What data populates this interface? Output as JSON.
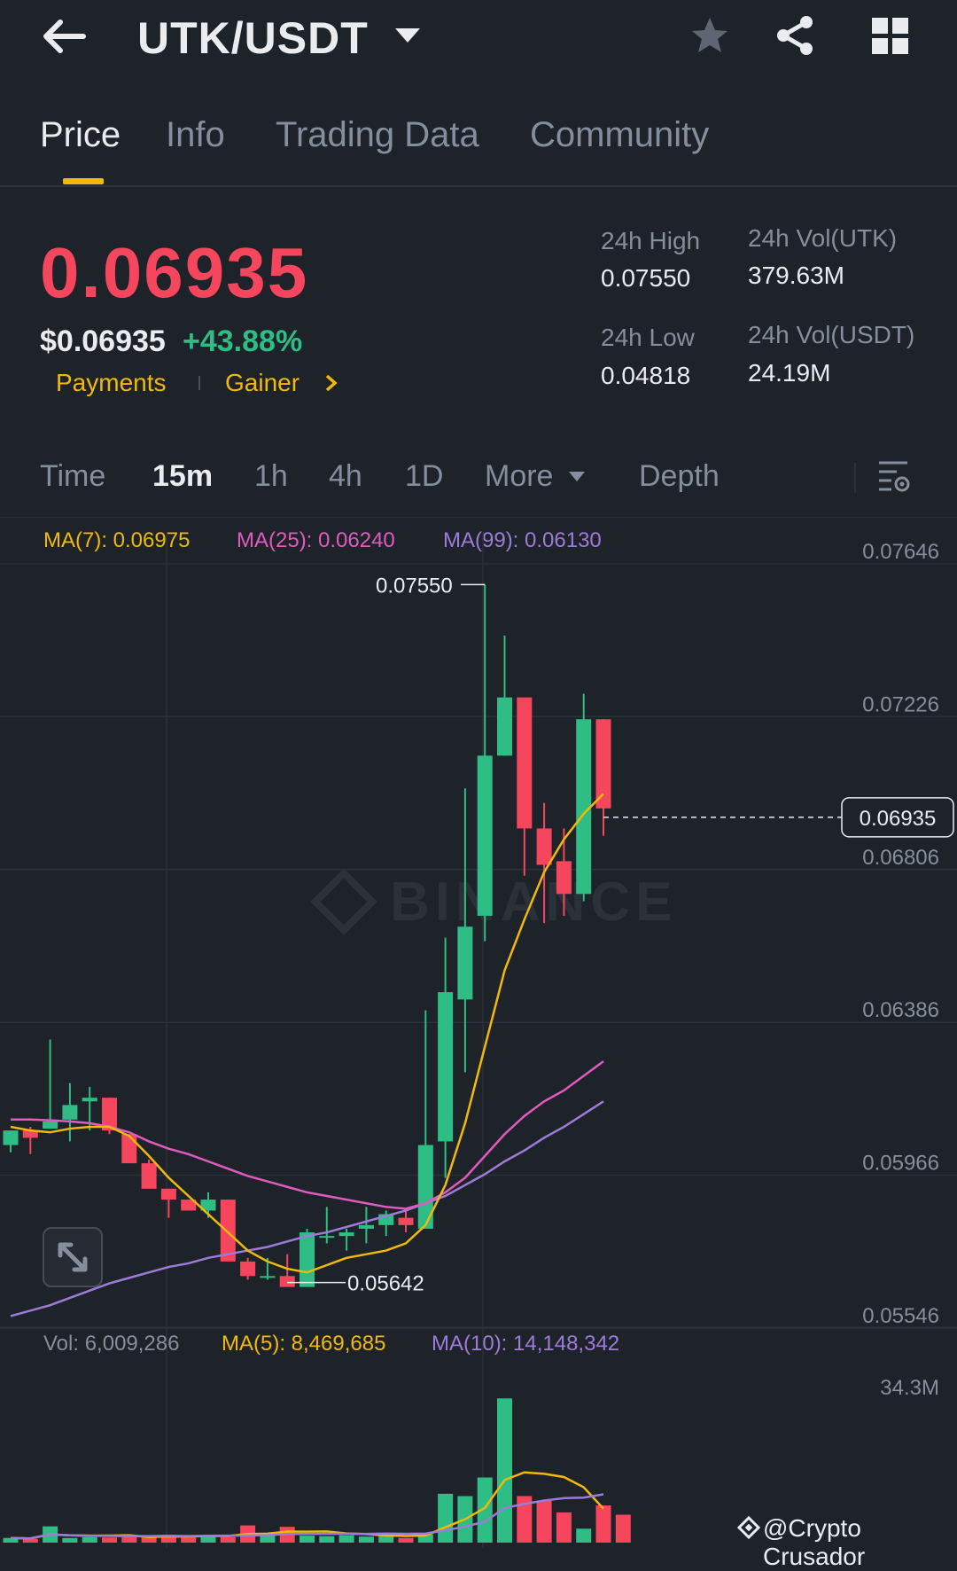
{
  "header": {
    "pair": "UTK/USDT",
    "icons": [
      "back-arrow-icon",
      "caret-down-icon",
      "star-icon",
      "share-icon",
      "grid-icon"
    ]
  },
  "tabs": [
    {
      "label": "Price",
      "active": true
    },
    {
      "label": "Info"
    },
    {
      "label": "Trading Data"
    },
    {
      "label": "Community"
    }
  ],
  "ticker": {
    "last_price": "0.06935",
    "usd_price": "$0.06935",
    "change_pct": "+43.88%",
    "tags": [
      "Payments",
      "Gainer"
    ],
    "high_label": "24h High",
    "high": "0.07550",
    "low_label": "24h Low",
    "low": "0.04818",
    "vol_base_label": "24h Vol(UTK)",
    "vol_base": "379.63M",
    "vol_quote_label": "24h Vol(USDT)",
    "vol_quote": "24.19M"
  },
  "intervals": [
    {
      "label": "Time"
    },
    {
      "label": "15m",
      "active": true
    },
    {
      "label": "1h"
    },
    {
      "label": "4h"
    },
    {
      "label": "1D"
    },
    {
      "label": "More"
    },
    {
      "label": "Depth"
    }
  ],
  "ma": {
    "ma7": "MA(7): 0.06975",
    "ma25": "MA(25): 0.06240",
    "ma99": "MA(99): 0.06130"
  },
  "vol_indicator": {
    "vol": "Vol: 6,009,286",
    "ma5": "MA(5): 8,469,685",
    "ma10": "MA(10): 14,148,342"
  },
  "watermark": "@Crypto Crusador",
  "colors": {
    "up": "#2ebd85",
    "down": "#f6465d",
    "ma7": "#f0b90b",
    "ma25": "#e05ac0",
    "ma99": "#9c7bd9",
    "accent": "#f0b90b",
    "bg": "#1e2329"
  },
  "chart_data": {
    "type": "candlestick",
    "y_ticks": [
      "0.07646",
      "0.07226",
      "0.06806",
      "0.06386",
      "0.05966",
      "0.05546"
    ],
    "ylim": [
      0.05546,
      0.07646
    ],
    "current_price_label": "0.06935",
    "high_marker": "0.07550",
    "low_marker": "0.05642",
    "candles": [
      {
        "o": 0.0601,
        "h": 0.0605,
        "l": 0.0599,
        "c": 0.0605
      },
      {
        "o": 0.0605,
        "h": 0.0606,
        "l": 0.05985,
        "c": 0.0603
      },
      {
        "o": 0.06055,
        "h": 0.063,
        "l": 0.06055,
        "c": 0.06075
      },
      {
        "o": 0.0608,
        "h": 0.0618,
        "l": 0.0602,
        "c": 0.0612
      },
      {
        "o": 0.0613,
        "h": 0.0617,
        "l": 0.0605,
        "c": 0.0614
      },
      {
        "o": 0.0614,
        "h": 0.0614,
        "l": 0.0604,
        "c": 0.0605
      },
      {
        "o": 0.0604,
        "h": 0.0604,
        "l": 0.0596,
        "c": 0.0596
      },
      {
        "o": 0.0596,
        "h": 0.0597,
        "l": 0.0589,
        "c": 0.0589
      },
      {
        "o": 0.0589,
        "h": 0.0589,
        "l": 0.0581,
        "c": 0.0586
      },
      {
        "o": 0.0586,
        "h": 0.0586,
        "l": 0.0583,
        "c": 0.0583
      },
      {
        "o": 0.0583,
        "h": 0.0588,
        "l": 0.0581,
        "c": 0.0586
      },
      {
        "o": 0.0586,
        "h": 0.0586,
        "l": 0.0569,
        "c": 0.0569
      },
      {
        "o": 0.0569,
        "h": 0.057,
        "l": 0.0564,
        "c": 0.0565
      },
      {
        "o": 0.0565,
        "h": 0.057,
        "l": 0.0564,
        "c": 0.0565
      },
      {
        "o": 0.0565,
        "h": 0.0571,
        "l": 0.05642,
        "c": 0.0562
      },
      {
        "o": 0.0562,
        "h": 0.0578,
        "l": 0.0562,
        "c": 0.0577
      },
      {
        "o": 0.0576,
        "h": 0.0584,
        "l": 0.0574,
        "c": 0.0576
      },
      {
        "o": 0.0576,
        "h": 0.0578,
        "l": 0.0572,
        "c": 0.0577
      },
      {
        "o": 0.0578,
        "h": 0.0584,
        "l": 0.0574,
        "c": 0.0579
      },
      {
        "o": 0.0579,
        "h": 0.0583,
        "l": 0.0576,
        "c": 0.0582
      },
      {
        "o": 0.0581,
        "h": 0.0583,
        "l": 0.0577,
        "c": 0.0579
      },
      {
        "o": 0.0578,
        "h": 0.0638,
        "l": 0.0578,
        "c": 0.0601
      },
      {
        "o": 0.0602,
        "h": 0.0658,
        "l": 0.0592,
        "c": 0.0643
      },
      {
        "o": 0.0641,
        "h": 0.0699,
        "l": 0.0621,
        "c": 0.0661
      },
      {
        "o": 0.0664,
        "h": 0.0755,
        "l": 0.0657,
        "c": 0.0708
      },
      {
        "o": 0.0708,
        "h": 0.0741,
        "l": 0.0708,
        "c": 0.0724
      },
      {
        "o": 0.0724,
        "h": 0.0724,
        "l": 0.0675,
        "c": 0.0688
      },
      {
        "o": 0.0688,
        "h": 0.0695,
        "l": 0.0662,
        "c": 0.0678
      },
      {
        "o": 0.0679,
        "h": 0.0688,
        "l": 0.0664,
        "c": 0.067
      },
      {
        "o": 0.067,
        "h": 0.0725,
        "l": 0.0668,
        "c": 0.0718
      },
      {
        "o": 0.0718,
        "h": 0.0718,
        "l": 0.0686,
        "c": 0.06935
      }
    ],
    "ma7": [
      0.0606,
      0.0605,
      0.06045,
      0.06055,
      0.0606,
      0.0606,
      0.06035,
      0.0598,
      0.0592,
      0.0587,
      0.0582,
      0.0577,
      0.0572,
      0.0569,
      0.0567,
      0.0566,
      0.0568,
      0.057,
      0.0571,
      0.0572,
      0.0574,
      0.0579,
      0.059,
      0.0607,
      0.0628,
      0.0649,
      0.0663,
      0.0676,
      0.0685,
      0.0692,
      0.06975
    ],
    "ma25": [
      0.0608,
      0.0608,
      0.06078,
      0.06075,
      0.0607,
      0.0606,
      0.06045,
      0.0602,
      0.06,
      0.05985,
      0.05965,
      0.05945,
      0.05925,
      0.0591,
      0.05895,
      0.0588,
      0.0587,
      0.0586,
      0.0585,
      0.0584,
      0.05835,
      0.0585,
      0.0588,
      0.0592,
      0.0598,
      0.0604,
      0.0609,
      0.0613,
      0.0616,
      0.062,
      0.0624
    ],
    "ma99": [
      0.0554,
      0.05555,
      0.0557,
      0.0559,
      0.0561,
      0.0563,
      0.05645,
      0.0566,
      0.05675,
      0.05685,
      0.057,
      0.0571,
      0.0572,
      0.0573,
      0.05745,
      0.0576,
      0.0577,
      0.05785,
      0.058,
      0.05815,
      0.0583,
      0.0585,
      0.0587,
      0.059,
      0.0593,
      0.05965,
      0.05995,
      0.0603,
      0.0606,
      0.06095,
      0.0613
    ],
    "volume": {
      "max_label": "34.3M",
      "ymax": 34.3,
      "values": [
        1.0,
        0.8,
        3.5,
        1.0,
        1.2,
        1.1,
        1.2,
        1.5,
        1.7,
        1.1,
        1.6,
        1.2,
        3.7,
        2.0,
        3.4,
        1.5,
        1.4,
        1.6,
        1.3,
        1.9,
        1.0,
        1.8,
        10.5,
        10.0,
        14.0,
        31.0,
        10.0,
        9.0,
        6.5,
        3.0,
        8.0,
        6.0
      ]
    }
  }
}
